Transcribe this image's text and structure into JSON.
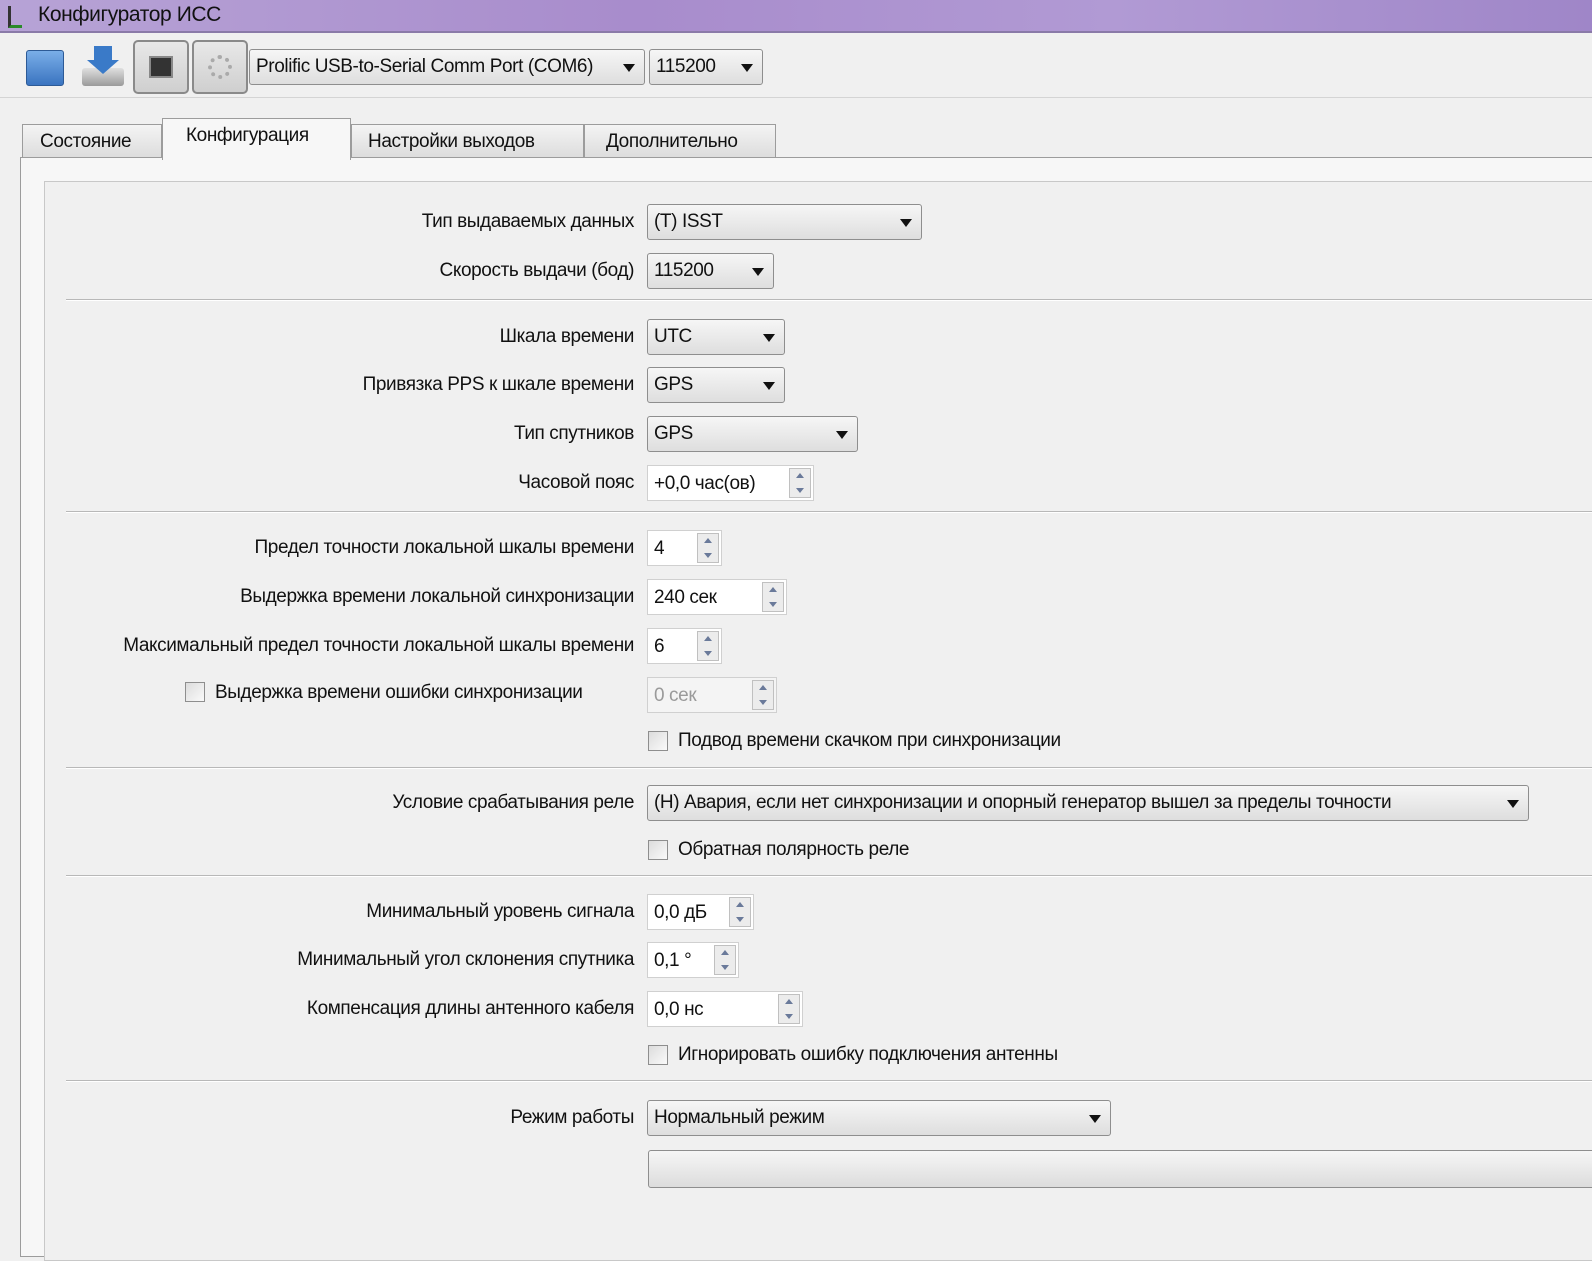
{
  "window": {
    "title": "Конфигуратор ИСС"
  },
  "toolbar": {
    "port": "Prolific USB-to-Serial Comm Port (COM6)",
    "baud": "115200"
  },
  "tabs": [
    "Состояние",
    "Конфигурация",
    "Настройки выходов",
    "Дополнительно"
  ],
  "form": {
    "data_type": {
      "label": "Тип выдаваемых  данных",
      "value": "(T) ISST"
    },
    "out_speed": {
      "label": "Скорость выдачи (бод)",
      "value": "115200"
    },
    "time_scale": {
      "label": "Шкала времени",
      "value": "UTC"
    },
    "pps_binding": {
      "label": "Привязка PPS к шкале времени",
      "value": "GPS"
    },
    "sat_type": {
      "label": "Тип спутников",
      "value": "GPS"
    },
    "timezone": {
      "label": "Часовой пояс",
      "value": "+0,0 час(ов)"
    },
    "accuracy_limit": {
      "label": "Предел  точности локальной шкалы времени",
      "value": "4"
    },
    "sync_delay": {
      "label": "Выдержка времени локальной синхронизации",
      "value": "240 сек"
    },
    "max_accuracy": {
      "label": "Максимальный предел точности локальной шкалы времени",
      "value": "6"
    },
    "sync_error_delay": {
      "label": "Выдержка времени ошибки синхронизации",
      "value": "0 сек",
      "checked": false
    },
    "jump_sync": {
      "label": "Подвод времени скачком при синхронизации",
      "checked": false
    },
    "relay_condition": {
      "label": "Условие срабатывания реле",
      "value": "(Н) Авария, если нет синхронизации и опорный генератор вышел за пределы точности"
    },
    "relay_inverse": {
      "label": "Обратная полярность реле",
      "checked": false
    },
    "min_signal": {
      "label": "Минимальный уровень сигнала",
      "value": "0,0 дБ"
    },
    "min_elevation": {
      "label": "Минимальный угол склонения спутника",
      "value": "0,1 °"
    },
    "cable_comp": {
      "label": "Компенсация длины антенного кабеля",
      "value": "0,0 нс"
    },
    "ignore_antenna": {
      "label": "Игнорировать ошибку подключения антенны",
      "checked": false
    },
    "mode": {
      "label": "Режим работы",
      "value": "Нормальный режим"
    }
  }
}
